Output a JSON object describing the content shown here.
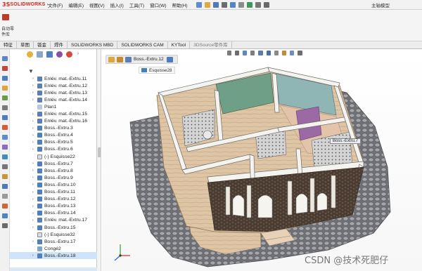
{
  "app": {
    "logo_ds": "3S",
    "logo_name": "SOLIDWORKS",
    "title": "主轴模型"
  },
  "menus": [
    {
      "key": "file",
      "label": "文件(F)"
    },
    {
      "key": "edit",
      "label": "编辑(E)"
    },
    {
      "key": "view",
      "label": "视图(V)"
    },
    {
      "key": "insert",
      "label": "插入(I)"
    },
    {
      "key": "tools",
      "label": "工具(T)"
    },
    {
      "key": "window",
      "label": "窗口(W)"
    },
    {
      "key": "help",
      "label": "帮助(H)"
    }
  ],
  "ribbon": {
    "big_button_line1": "自动零",
    "big_button_line2": "件库"
  },
  "tabs": [
    {
      "label": "特征",
      "state": "normal"
    },
    {
      "label": "草图",
      "state": "normal"
    },
    {
      "label": "钣金",
      "state": "normal"
    },
    {
      "label": "焊件",
      "state": "normal"
    },
    {
      "label": "SOLIDWORKS MBD",
      "state": "normal"
    },
    {
      "label": "SOLIDWORKS CAM",
      "state": "normal"
    },
    {
      "label": "KYTool",
      "state": "normal"
    },
    {
      "label": "3DSource零件库",
      "state": "dim"
    }
  ],
  "tree": [
    {
      "label": "Enlév. mat.-Extru.11",
      "icon": "cut-extrude-icon",
      "expand": true
    },
    {
      "label": "Enlév. mat.-Extru.12",
      "icon": "cut-extrude-icon",
      "expand": true
    },
    {
      "label": "Enlév. mat.-Extru.13",
      "icon": "cut-extrude-icon",
      "expand": true
    },
    {
      "label": "Enlév. mat.-Extru.14",
      "icon": "cut-extrude-icon",
      "expand": true
    },
    {
      "label": "Plan1",
      "icon": "plane-icon",
      "expand": false
    },
    {
      "label": "Enlév. mat.-Extru.15",
      "icon": "cut-extrude-icon",
      "expand": true
    },
    {
      "label": "Enlév. mat.-Extru.16",
      "icon": "cut-extrude-icon",
      "expand": true
    },
    {
      "label": "Boss.-Extru.3",
      "icon": "boss-extrude-icon",
      "expand": true
    },
    {
      "label": "Boss.-Extru.4",
      "icon": "boss-extrude-icon",
      "expand": true
    },
    {
      "label": "Boss.-Extru.5",
      "icon": "boss-extrude-icon",
      "expand": true
    },
    {
      "label": "Boss.-Extru.6",
      "icon": "boss-extrude-icon",
      "expand": true
    },
    {
      "label": "(-) Esquisse22",
      "icon": "sketch-icon",
      "expand": false
    },
    {
      "label": "Boss.-Extru.7",
      "icon": "boss-extrude-icon",
      "expand": true
    },
    {
      "label": "Boss.-Extru.8",
      "icon": "boss-extrude-icon",
      "expand": true
    },
    {
      "label": "Boss.-Extru.9",
      "icon": "boss-extrude-icon",
      "expand": true
    },
    {
      "label": "Boss.-Extru.10",
      "icon": "boss-extrude-icon",
      "expand": true
    },
    {
      "label": "Boss.-Extru.11",
      "icon": "boss-extrude-icon",
      "expand": true
    },
    {
      "label": "Boss.-Extru.12",
      "icon": "boss-extrude-icon",
      "expand": true
    },
    {
      "label": "Boss.-Extru.13",
      "icon": "boss-extrude-icon",
      "expand": true
    },
    {
      "label": "Boss.-Extru.14",
      "icon": "boss-extrude-icon",
      "expand": true
    },
    {
      "label": "Enlév. mat.-Extru.17",
      "icon": "cut-extrude-icon",
      "expand": true
    },
    {
      "label": "Boss.-Extru.15",
      "icon": "boss-extrude-icon",
      "expand": true
    },
    {
      "label": "(-) Esquisse32",
      "icon": "sketch-icon",
      "expand": false
    },
    {
      "label": "Boss.-Extru.17",
      "icon": "boss-extrude-icon",
      "expand": true
    },
    {
      "label": "Congé2",
      "icon": "fillet-icon",
      "expand": false
    },
    {
      "label": "Boss.-Extru.18",
      "icon": "boss-extrude-icon",
      "expand": true,
      "selected": true
    }
  ],
  "viewport": {
    "breadcrumb_feature": "Boss.-Extru.12",
    "breadcrumb_sketch": "Esquisse28",
    "tooltip": "Boss.-Extru.7"
  },
  "watermark": "CSDN @技术死肥仔",
  "colors": {
    "accent": "#d8281e",
    "tree_selected": "#cfe3fb",
    "wall": "#f4f3ee",
    "floor": "#e2c9ad",
    "cobblestone": "#7d7f84",
    "teal_room": "#6f9f86",
    "blue_room": "#8fb6b5",
    "purple_panel": "#9b6aa4"
  }
}
